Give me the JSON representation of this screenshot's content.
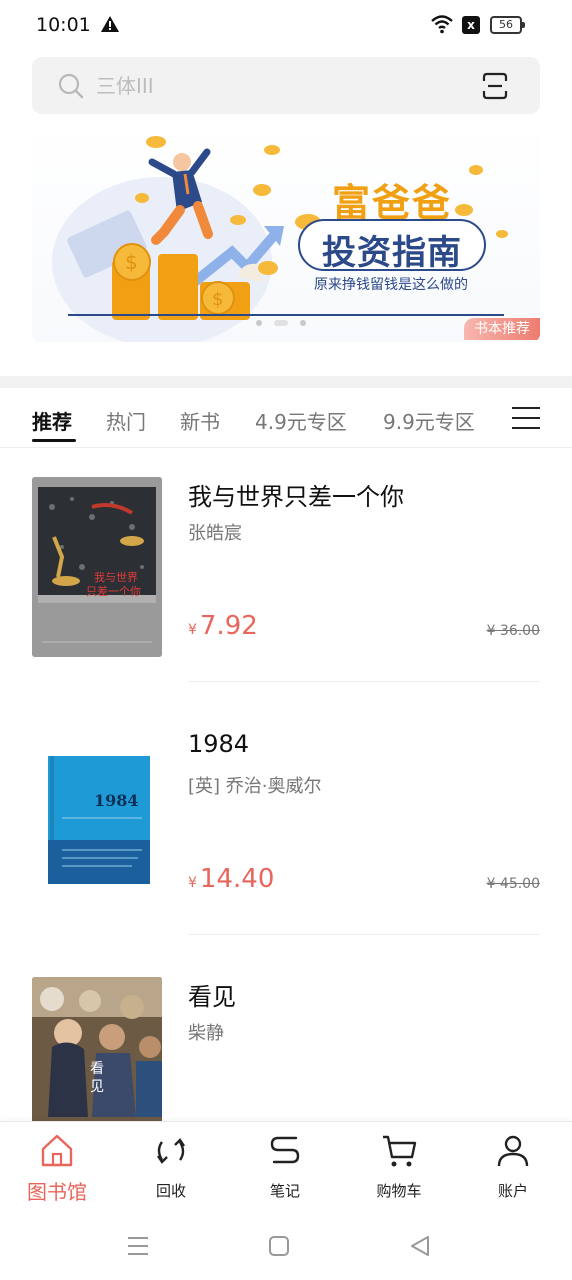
{
  "status_bar": {
    "time": "10:01",
    "battery": "56",
    "sim_label": "x"
  },
  "search": {
    "placeholder": "三体III"
  },
  "banner": {
    "line1": "富爸爸",
    "line2": "投资指南",
    "subtitle": "原来挣钱留钱是这么做的",
    "tag": "书本推荐",
    "slide_count": 3,
    "active_slide": 2
  },
  "tabs": [
    {
      "label": "推荐",
      "active": true
    },
    {
      "label": "热门",
      "active": false
    },
    {
      "label": "新书",
      "active": false
    },
    {
      "label": "4.9元专区",
      "active": false
    },
    {
      "label": "9.9元专区",
      "active": false
    }
  ],
  "books": [
    {
      "title": "我与世界只差一个你",
      "author": "张皓宸",
      "currency": "¥",
      "price": "7.92",
      "original_price": "¥ 36.00",
      "cover_text": "我与世界\n只差一个你"
    },
    {
      "title": "1984",
      "author": "[英] 乔治·奥威尔",
      "currency": "¥",
      "price": "14.40",
      "original_price": "¥ 45.00",
      "cover_text": "1984"
    },
    {
      "title": "看见",
      "author": "柴静",
      "currency": "¥",
      "price": "",
      "original_price": "",
      "cover_text": "看见"
    }
  ],
  "bottom_nav": [
    {
      "label": "图书馆",
      "icon": "home-icon",
      "active": true
    },
    {
      "label": "回收",
      "icon": "recycle-icon",
      "active": false
    },
    {
      "label": "笔记",
      "icon": "notes-icon",
      "active": false
    },
    {
      "label": "购物车",
      "icon": "cart-icon",
      "active": false
    },
    {
      "label": "账户",
      "icon": "user-icon",
      "active": false
    }
  ],
  "colors": {
    "accent": "#e8665c",
    "banner_gold": "#f2a013",
    "banner_blue": "#2c4a8a"
  }
}
